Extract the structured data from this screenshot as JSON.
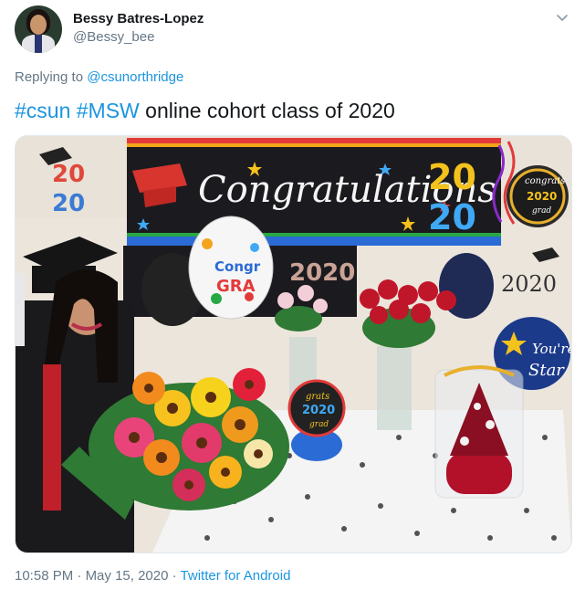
{
  "author": {
    "name": "Bessy Batres-Lopez",
    "handle": "@Bessy_bee"
  },
  "reply": {
    "prefix": "Replying to",
    "mention": "@csunorthridge"
  },
  "tweet": {
    "hashtag1": "#csun",
    "hashtag2": "#MSW",
    "text": "online cohort class of 2020"
  },
  "photo": {
    "banner_text": "Congratulations",
    "banner_year_top": "20",
    "banner_year_bottom": "20",
    "left_sign_top": "20",
    "left_sign_bottom": "20",
    "balloon_text_1": "Congr",
    "balloon_text_2": "GRA",
    "right_sign_1": "congrats",
    "right_sign_2": "2020",
    "right_sign_3": "grad",
    "right_2020": "2020",
    "star_balloon_1": "You're",
    "star_balloon_2": "Star",
    "centerpiece_1": "grats",
    "centerpiece_2": "2020",
    "centerpiece_3": "grad",
    "colors": {
      "wall": "#efe9e1",
      "banner": "#1c1c1c",
      "tablecloth": "#f2f2f2"
    }
  },
  "meta": {
    "time": "10:58 PM",
    "date": "May 15, 2020",
    "separator": "·",
    "source": "Twitter for Android"
  },
  "icons": {
    "chevron": "chevron-down-icon"
  },
  "colors": {
    "link": "#1b95e0",
    "secondary": "#657786",
    "primary_text": "#14171a"
  }
}
